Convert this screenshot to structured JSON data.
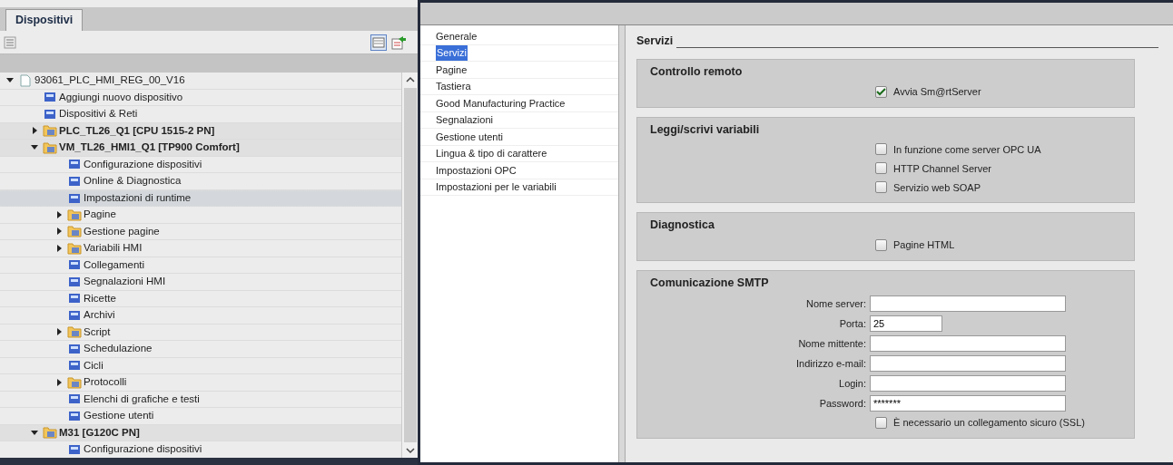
{
  "devices_panel": {
    "tab": {
      "label": "Dispositivi",
      "selected": true
    },
    "tree": [
      {
        "label": "93061_PLC_HMI_REG_00_V16",
        "kind": "project",
        "expanded": true,
        "selected": false,
        "children": [
          {
            "label": "Aggiungi nuovo dispositivo",
            "kind": "item",
            "selected": false
          },
          {
            "label": "Dispositivi & Reti",
            "kind": "item",
            "selected": false
          },
          {
            "label": "PLC_TL26_Q1 [CPU 1515-2 PN]",
            "kind": "device",
            "expanded": false,
            "selected": false
          },
          {
            "label": "VM_TL26_HMI1_Q1 [TP900 Comfort]",
            "kind": "device",
            "expanded": true,
            "selected": false,
            "children": [
              {
                "label": "Configurazione dispositivi",
                "kind": "item",
                "selected": false
              },
              {
                "label": "Online & Diagnostica",
                "kind": "item",
                "selected": false
              },
              {
                "label": "Impostazioni di runtime",
                "kind": "item",
                "selected": true
              },
              {
                "label": "Pagine",
                "kind": "folder",
                "expanded": false,
                "selected": false
              },
              {
                "label": "Gestione pagine",
                "kind": "folder",
                "expanded": false,
                "selected": false
              },
              {
                "label": "Variabili HMI",
                "kind": "folder",
                "expanded": false,
                "selected": false
              },
              {
                "label": "Collegamenti",
                "kind": "item",
                "selected": false
              },
              {
                "label": "Segnalazioni HMI",
                "kind": "item",
                "selected": false
              },
              {
                "label": "Ricette",
                "kind": "item",
                "selected": false
              },
              {
                "label": "Archivi",
                "kind": "item",
                "selected": false
              },
              {
                "label": "Script",
                "kind": "folder",
                "expanded": false,
                "selected": false
              },
              {
                "label": "Schedulazione",
                "kind": "item",
                "selected": false
              },
              {
                "label": "Cicli",
                "kind": "item",
                "selected": false
              },
              {
                "label": "Protocolli",
                "kind": "folder",
                "expanded": false,
                "selected": false
              },
              {
                "label": "Elenchi di grafiche e testi",
                "kind": "item",
                "selected": false
              },
              {
                "label": "Gestione utenti",
                "kind": "item",
                "selected": false
              }
            ]
          },
          {
            "label": "M31 [G120C PN]",
            "kind": "device",
            "expanded": true,
            "selected": false,
            "children": [
              {
                "label": "Configurazione dispositivi",
                "kind": "item",
                "selected": false
              }
            ]
          }
        ]
      }
    ]
  },
  "settings_nav": [
    {
      "label": "Generale",
      "selected": false
    },
    {
      "label": "Servizi",
      "selected": true
    },
    {
      "label": "Pagine",
      "selected": false
    },
    {
      "label": "Tastiera",
      "selected": false
    },
    {
      "label": "Good Manufacturing Practice",
      "selected": false
    },
    {
      "label": "Segnalazioni",
      "selected": false
    },
    {
      "label": "Gestione utenti",
      "selected": false
    },
    {
      "label": "Lingua & tipo di carattere",
      "selected": false
    },
    {
      "label": "Impostazioni OPC",
      "selected": false
    },
    {
      "label": "Impostazioni per le variabili",
      "selected": false
    }
  ],
  "content": {
    "title": "Servizi",
    "sections": [
      {
        "title": "Controllo remoto",
        "rows": [
          {
            "kind": "checkbox",
            "label": "Avvia Sm@rtServer",
            "checked": true
          }
        ]
      },
      {
        "title": "Leggi/scrivi variabili",
        "rows": [
          {
            "kind": "checkbox",
            "label": "In funzione come server OPC UA",
            "checked": false
          },
          {
            "kind": "checkbox",
            "label": "HTTP Channel Server",
            "checked": false
          },
          {
            "kind": "checkbox",
            "label": "Servizio web SOAP",
            "checked": false
          }
        ]
      },
      {
        "title": "Diagnostica",
        "rows": [
          {
            "kind": "checkbox",
            "label": "Pagine HTML",
            "checked": false
          }
        ]
      },
      {
        "title": "Comunicazione SMTP",
        "rows": [
          {
            "kind": "field",
            "label": "Nome server:",
            "value": ""
          },
          {
            "kind": "short_field",
            "label": "Porta:",
            "value": "25"
          },
          {
            "kind": "field",
            "label": "Nome mittente:",
            "value": ""
          },
          {
            "kind": "field",
            "label": "Indirizzo e-mail:",
            "value": ""
          },
          {
            "kind": "field",
            "label": "Login:",
            "value": ""
          },
          {
            "kind": "field",
            "label": "Password:",
            "value": "*******"
          },
          {
            "kind": "checkbox",
            "label": "È necessario un collegamento sicuro (SSL)",
            "checked": false
          }
        ]
      }
    ]
  }
}
